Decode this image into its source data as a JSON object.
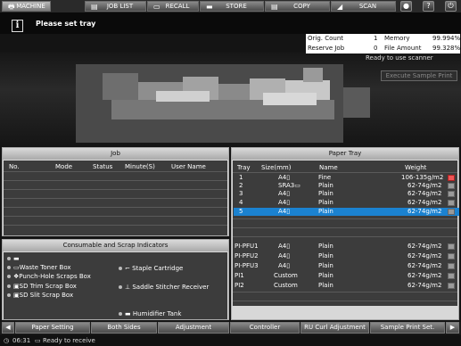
{
  "tabs": [
    {
      "label": "MACHINE",
      "icon": "printer-icon",
      "glyph": "🖶"
    },
    {
      "label": "JOB LIST",
      "icon": "list-icon",
      "glyph": "▤"
    },
    {
      "label": "RECALL",
      "icon": "recall-icon",
      "glyph": "▭"
    },
    {
      "label": "STORE",
      "icon": "store-icon",
      "glyph": "▬"
    },
    {
      "label": "COPY",
      "icon": "copy-icon",
      "glyph": "▤"
    },
    {
      "label": "SCAN",
      "icon": "scan-icon",
      "glyph": "◢"
    }
  ],
  "message": "Please set tray",
  "counter": {
    "orig_count_label": "Orig. Count",
    "orig_count_value": "1",
    "memory_label": "Memory",
    "memory_value": "99.994%",
    "reserve_job_label": "Reserve Job",
    "reserve_job_value": "0",
    "file_amount_label": "File Amount",
    "file_amount_value": "99.328%"
  },
  "scanner_status": "Ready to use scanner",
  "execute_sample_print": "Execute Sample Print",
  "job": {
    "title": "Job",
    "headers": [
      "No.",
      "Mode",
      "Status",
      "Minute(S)",
      "User Name"
    ]
  },
  "paper_tray": {
    "title": "Paper Tray",
    "headers": [
      "Tray",
      "Size(mm)",
      "Name",
      "Weight"
    ],
    "rows": [
      {
        "tray": "1",
        "size": "A4▯",
        "name": "Fine",
        "weight": "106-135g/m2",
        "gauge": "red"
      },
      {
        "tray": "2",
        "size": "SRA3▭",
        "name": "Plain",
        "weight": "62-74g/m2",
        "gauge": "gray"
      },
      {
        "tray": "3",
        "size": "A4▯",
        "name": "Plain",
        "weight": "62-74g/m2",
        "gauge": "gray"
      },
      {
        "tray": "4",
        "size": "A4▯",
        "name": "Plain",
        "weight": "62-74g/m2",
        "gauge": "gray"
      },
      {
        "tray": "5",
        "size": "A4▯",
        "name": "Plain",
        "weight": "62-74g/m2",
        "gauge": "gray",
        "selected": true
      },
      {
        "tray": "PI-PFU1",
        "size": "A4▯",
        "name": "Plain",
        "weight": "62-74g/m2",
        "gauge": "gray"
      },
      {
        "tray": "PI-PFU2",
        "size": "A4▯",
        "name": "Plain",
        "weight": "62-74g/m2",
        "gauge": "gray"
      },
      {
        "tray": "PI-PFU3",
        "size": "A4▯",
        "name": "Plain",
        "weight": "62-74g/m2",
        "gauge": "gray"
      },
      {
        "tray": "PI1",
        "size": "Custom",
        "name": "Plain",
        "weight": "62-74g/m2",
        "gauge": "gray"
      },
      {
        "tray": "PI2",
        "size": "Custom",
        "name": "Plain",
        "weight": "62-74g/m2",
        "gauge": "gray"
      }
    ]
  },
  "consumables": {
    "title": "Consumable and Scrap Indicators",
    "left": [
      {
        "label": "",
        "icon": "toner-icon",
        "glyph": "▬"
      },
      {
        "label": "Waste Toner Box",
        "icon": "waste-toner-icon",
        "glyph": "▭"
      },
      {
        "label": "Punch-Hole Scraps Box",
        "icon": "punch-icon",
        "glyph": "❖"
      },
      {
        "label": "SD Trim Scrap Box",
        "icon": "trim-box-icon",
        "glyph": "▣"
      },
      {
        "label": "SD Slit Scrap Box",
        "icon": "slit-box-icon",
        "glyph": "▣"
      }
    ],
    "right": [
      {
        "label": "Staple Cartridge",
        "icon": "staple-icon",
        "glyph": "⌐"
      },
      {
        "label": "Saddle Stitcher Receiver",
        "icon": "saddle-icon",
        "glyph": "⊥"
      },
      {
        "label": "Humidifier Tank",
        "icon": "humidifier-icon",
        "glyph": "▬"
      }
    ]
  },
  "bottom_buttons": [
    "Paper Setting",
    "Both Sides",
    "Adjustment",
    "Controller",
    "RU Curl Adjustment",
    "Sample Print Set."
  ],
  "status": {
    "time": "06:31",
    "text": "Ready to receive"
  }
}
